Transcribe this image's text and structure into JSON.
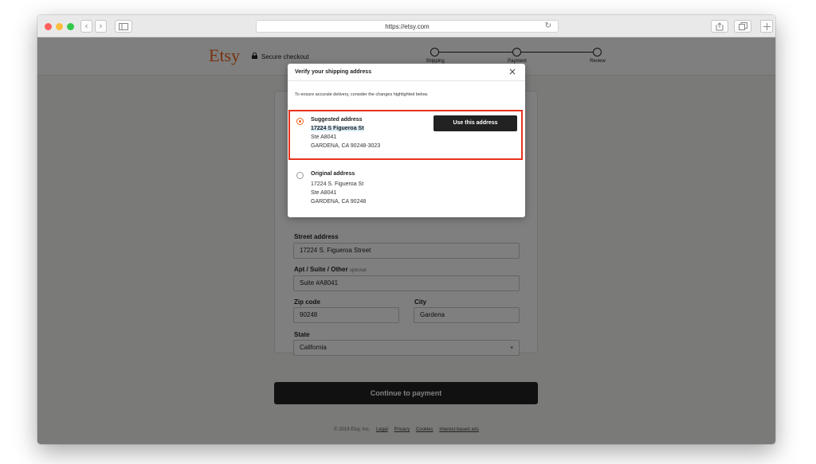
{
  "browser": {
    "url": "https://etsy.com",
    "back_icon": "‹",
    "forward_icon": "›",
    "reload_icon": "↻",
    "colors": {
      "close": "#fc605c",
      "minimize": "#fdbc40",
      "maximize": "#34c84a"
    }
  },
  "header": {
    "logo": "Etsy",
    "secure_label": "Secure checkout",
    "steps": [
      "Shipping",
      "Payment",
      "Review"
    ]
  },
  "form": {
    "street_label": "Street address",
    "street_value": "17224 S. Figueroa Street",
    "apt_label": "Apt / Suite / Other",
    "apt_optional": "optional",
    "apt_value": "Suite #A8041",
    "zip_label": "Zip code",
    "zip_value": "90248",
    "city_label": "City",
    "city_value": "Gardena",
    "state_label": "State",
    "state_value": "California",
    "select_arrow": "▾"
  },
  "continue_label": "Continue to payment",
  "footer": {
    "copyright": "© 2019 Etsy, Inc.",
    "links": [
      "Legal",
      "Privacy",
      "Cookies",
      "Interest-based ads"
    ]
  },
  "modal": {
    "title": "Verify your shipping address",
    "close_icon": "×",
    "subtext": "To ensure accurate delivery, consider the changes highlighted below.",
    "suggested": {
      "heading": "Suggested address",
      "line1": "17224 S Figueroa St",
      "line2": "Ste A8041",
      "line3": "GARDENA, CA 90248-3023",
      "selected": true
    },
    "use_button": "Use this address",
    "original": {
      "heading": "Original address",
      "line1": "17224 S. Figueroa St",
      "line2": "Ste A8041",
      "line3": "GARDENA, CA 90248",
      "selected": false
    },
    "accent_color": "#f1641e",
    "highlight_color": "#e8321e"
  }
}
